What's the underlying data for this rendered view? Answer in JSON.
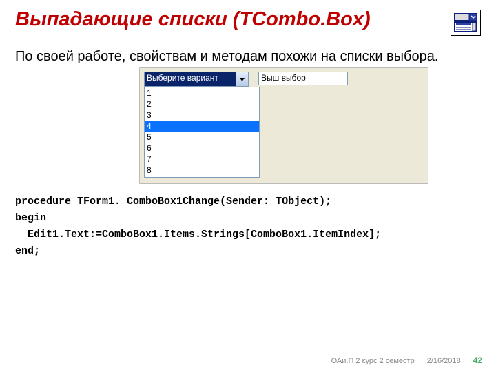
{
  "title": "Выпадающие списки (ТCombo.Box)",
  "intro": "По своей работе, свойствам и методам похожи на списки выбора.",
  "ui": {
    "combo_text": "Выберите вариант",
    "edit_text": "Выш выбор",
    "list_items": [
      "1",
      "2",
      "3",
      "4",
      "5",
      "6",
      "7",
      "8"
    ],
    "selected_index": 3
  },
  "code_lines": [
    "procedure TForm1. ComboBox1Change(Sender: TObject);",
    "begin",
    "  Edit1.Text:=ComboBox1.Items.Strings[ComboBox1.ItemIndex];",
    "end;"
  ],
  "footer": {
    "course": "ОАи.П 2 курс 2 семестр",
    "date": "2/16/2018",
    "page": "42"
  }
}
